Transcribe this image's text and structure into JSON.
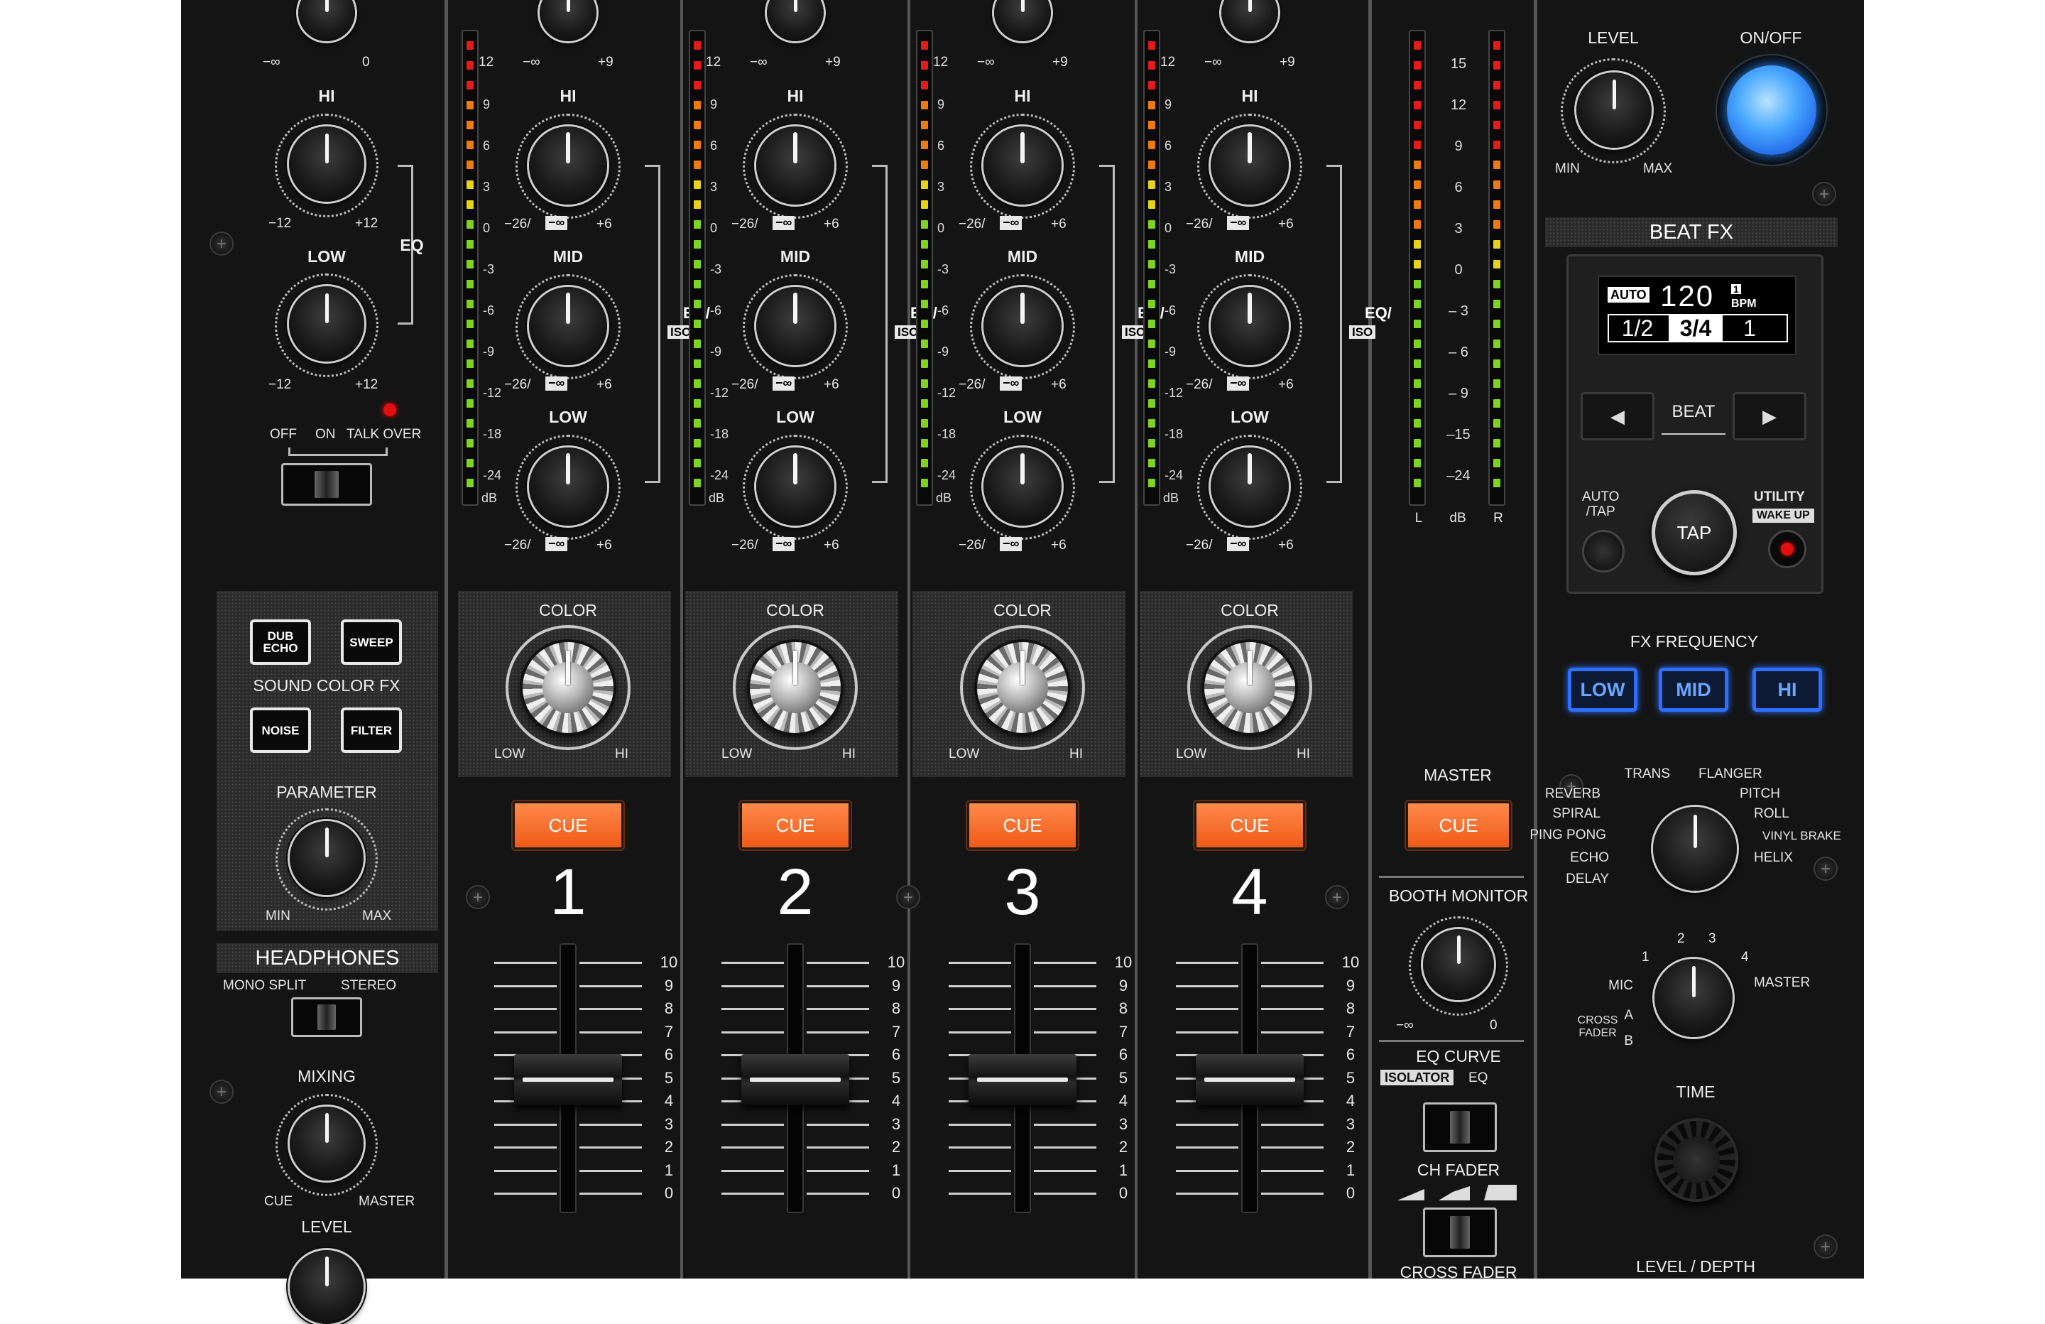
{
  "left_section": {
    "hi": "HI",
    "low": "LOW",
    "eq": "EQ",
    "minus_inf": "−∞",
    "zero": "0",
    "minus12": "−12",
    "plus12": "+12",
    "off": "OFF",
    "on": "ON",
    "talk_over": "TALK OVER",
    "dub_echo": "DUB ECHO",
    "sweep": "SWEEP",
    "sound_color_fx": "SOUND COLOR FX",
    "noise": "NOISE",
    "filter": "FILTER",
    "parameter": "PARAMETER",
    "min": "MIN",
    "max": "MAX",
    "headphones": "HEADPHONES",
    "mono_split": "MONO SPLIT",
    "stereo": "STEREO",
    "mixing": "MIXING",
    "cue": "CUE",
    "master": "MASTER",
    "level": "LEVEL"
  },
  "channels": [
    {
      "number": "1"
    },
    {
      "number": "2"
    },
    {
      "number": "3"
    },
    {
      "number": "4"
    }
  ],
  "channel_labels": {
    "hi": "HI",
    "mid": "MID",
    "low": "LOW",
    "eq_iso": "EQ/",
    "iso": "ISO",
    "minus26": "−26/",
    "minus_inf": "−∞",
    "plus6": "+6",
    "trim_min": "−∞",
    "trim_max": "+9",
    "color": "COLOR",
    "color_low": "LOW",
    "color_hi": "HI",
    "cue": "CUE",
    "db": "dB"
  },
  "channel_meter_scale": [
    "12",
    "9",
    "6",
    "3",
    "0",
    "-3",
    "-6",
    "-9",
    "-12",
    "-18",
    "-24"
  ],
  "fader_scale": [
    "10",
    "9",
    "8",
    "7",
    "6",
    "5",
    "4",
    "3",
    "2",
    "1",
    "0"
  ],
  "master_section": {
    "meter_scale": [
      "15",
      "12",
      "9",
      "6",
      "3",
      "0",
      "– 3",
      "– 6",
      "– 9",
      "–15",
      "–24"
    ],
    "l": "L",
    "db": "dB",
    "r": "R",
    "master": "MASTER",
    "cue": "CUE",
    "booth_monitor": "BOOTH MONITOR",
    "minus_inf": "−∞",
    "zero": "0",
    "eq_curve": "EQ CURVE",
    "isolator": "ISOLATOR",
    "eq": "EQ",
    "ch_fader": "CH FADER",
    "cross_fader": "CROSS FADER"
  },
  "beat_fx": {
    "level": "LEVEL",
    "on_off": "ON/OFF",
    "min": "MIN",
    "max": "MAX",
    "title": "BEAT FX",
    "auto": "AUTO",
    "bpm_value": "120",
    "bpm_decimal": "1",
    "bpm_unit": "BPM",
    "beat_half": "1/2",
    "beat_three_quarter": "3/4",
    "beat_one": "1",
    "beat": "BEAT",
    "left_arrow": "◀",
    "right_arrow": "▶",
    "auto_tap": "AUTO\n/TAP",
    "tap": "TAP",
    "utility": "UTILITY",
    "wake_up": "WAKE UP",
    "fx_frequency": "FX FREQUENCY",
    "low": "LOW",
    "mid": "MID",
    "hi": "HI",
    "effects": [
      "TRANS",
      "FLANGER",
      "REVERB",
      "PITCH",
      "SPIRAL",
      "ROLL",
      "PING PONG",
      "VINYL BRAKE",
      "ECHO",
      "HELIX",
      "DELAY"
    ],
    "ch_select": [
      "1",
      "2",
      "3",
      "4"
    ],
    "mic": "MIC",
    "master": "MASTER",
    "cross_fader_a": "A",
    "cross_fader_b": "B",
    "cross_fader": "CROSS FADER",
    "time": "TIME",
    "level_depth": "LEVEL / DEPTH"
  },
  "colors": {
    "accent_blue": "#2f6fff",
    "cue_orange": "#f26a1f",
    "body": "#141414"
  }
}
